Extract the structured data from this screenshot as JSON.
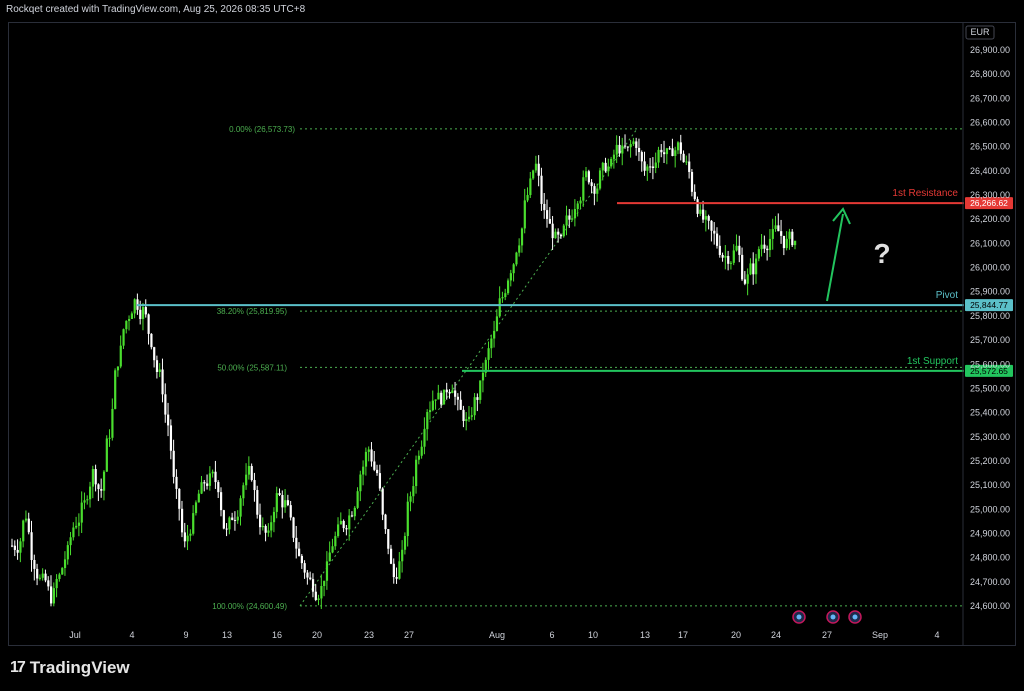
{
  "header": {
    "watermark": "Rockqet created with TradingView.com, Aug 25, 2026 08:35 UTC+8"
  },
  "footer": {
    "brand": "TradingView",
    "brand_mark": "17"
  },
  "colors": {
    "background": "#000000",
    "candle": "#4ade2e",
    "fib": "#4caf50",
    "resistance": "#e53935",
    "pivot": "#5bc0c9",
    "support": "#22c55e",
    "arrow": "#22c55e"
  },
  "chart_data": {
    "type": "candlestick",
    "currency": "EUR",
    "y_ticks": [
      26900,
      26800,
      26700,
      26600,
      26500,
      26400,
      26300,
      26200,
      26100,
      26000,
      25900,
      25800,
      25700,
      25600,
      25500,
      25400,
      25300,
      25200,
      25100,
      25000,
      24900,
      24800,
      24700,
      24600
    ],
    "y_tick_labels": [
      "26,900.00",
      "26,800.00",
      "26,700.00",
      "26,600.00",
      "26,500.00",
      "26,400.00",
      "26,300.00",
      "26,200.00",
      "26,100.00",
      "26,000.00",
      "25,900.00",
      "25,800.00",
      "25,700.00",
      "25,600.00",
      "25,500.00",
      "25,400.00",
      "25,300.00",
      "25,200.00",
      "25,100.00",
      "25,000.00",
      "24,900.00",
      "24,800.00",
      "24,700.00",
      "24,600.00"
    ],
    "ylim": [
      24560,
      26960
    ],
    "x_labels": [
      "Jul",
      "4",
      "9",
      "13",
      "16",
      "20",
      "23",
      "27",
      "Aug",
      "6",
      "10",
      "13",
      "17",
      "20",
      "24",
      "27",
      "Sep",
      "4"
    ],
    "fib_levels": [
      {
        "label": "0.00% (26,573.73)",
        "value": 26573.73
      },
      {
        "label": "38.20% (25,819.95)",
        "value": 25819.95
      },
      {
        "label": "50.00% (25,587.11)",
        "value": 25587.11
      },
      {
        "label": "100.00% (24,600.49)",
        "value": 24600.49
      }
    ],
    "levels": [
      {
        "name": "1st Resistance",
        "value": 26266.62,
        "value_label": "26,266.62"
      },
      {
        "name": "Pivot",
        "value": 25844.77,
        "value_label": "25,844.77"
      },
      {
        "name": "1st Support",
        "value": 25572.65,
        "value_label": "25,572.65"
      }
    ],
    "annotation": "?",
    "trend_closes": [
      24850,
      24980,
      24780,
      24700,
      24640,
      24720,
      24820,
      24950,
      25020,
      25150,
      25080,
      25320,
      25620,
      25780,
      25860,
      25820,
      25700,
      25550,
      25350,
      25050,
      24850,
      24950,
      25080,
      25120,
      25100,
      24900,
      24980,
      25100,
      25150,
      24950,
      24880,
      25050,
      25020,
      24900,
      24780,
      24700,
      24660,
      24750,
      24880,
      24940,
      25000,
      25150,
      25250,
      25150,
      24900,
      24720,
      24800,
      25060,
      25250,
      25420,
      25480,
      25460,
      25520,
      25400,
      25350,
      25470,
      25600,
      25720,
      25880,
      26000,
      26120,
      26300,
      26420,
      26220,
      26150,
      26100,
      26200,
      26300,
      26380,
      26340,
      26400,
      26420,
      26500,
      26480,
      26520,
      26400,
      26440,
      26500,
      26460,
      26500,
      26420,
      26300,
      26200,
      26140,
      26080,
      26050,
      26080,
      25950,
      26000,
      26100,
      26120,
      26150,
      26100,
      26110
    ]
  }
}
